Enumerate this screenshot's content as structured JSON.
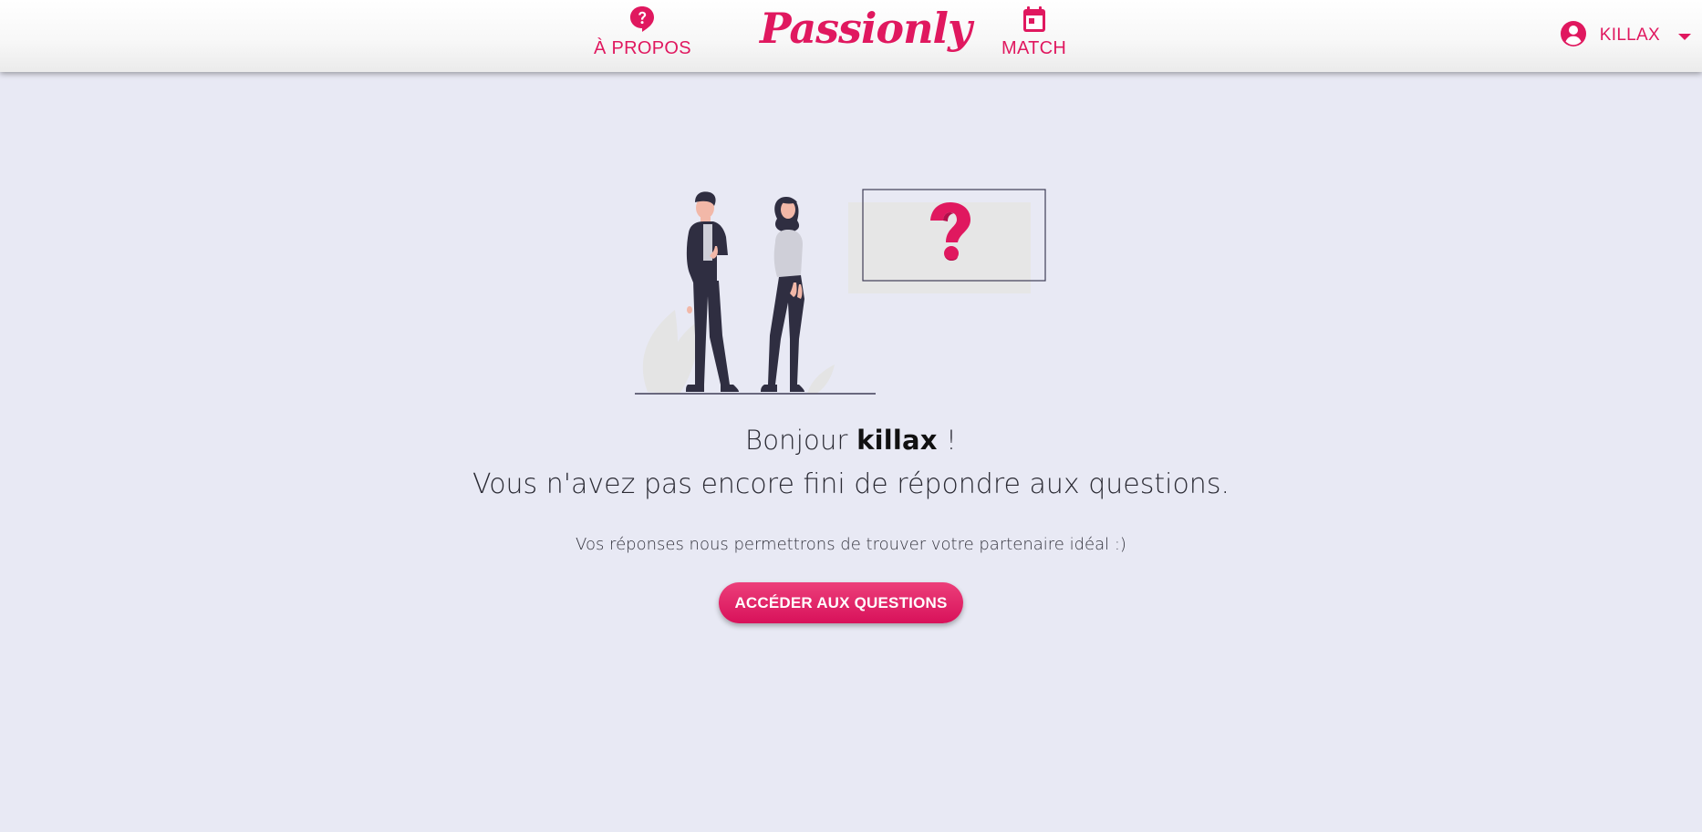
{
  "header": {
    "logo": "Passionly",
    "nav": {
      "about_label": "À PROPOS",
      "match_label": "MATCH"
    },
    "user": {
      "name": "KILLAX"
    }
  },
  "main": {
    "greeting_prefix": "Bonjour ",
    "username": "killax",
    "greeting_suffix": " !",
    "headline": "Vous n'avez pas encore fini de répondre aux questions.",
    "subline": "Vos réponses nous permettrons de trouver votre partenaire idéal :)",
    "cta_label": "ACCÉDER AUX QUESTIONS"
  },
  "colors": {
    "accent": "#e0185f",
    "background": "#e8e9f4",
    "header_bg": "#ffffff",
    "figure_dark": "#2f2e41"
  },
  "icons": {
    "about": "question-bubble-icon",
    "match": "calendar-icon",
    "user": "account-circle-icon",
    "dropdown": "caret-down-icon"
  }
}
